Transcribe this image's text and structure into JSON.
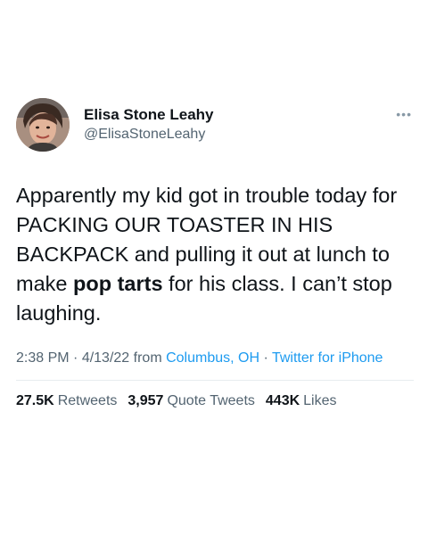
{
  "user": {
    "display_name": "Elisa Stone Leahy",
    "handle": "@ElisaStoneLeahy"
  },
  "more_icon": "more-options-icon",
  "tweet": {
    "text_part1": "Apparently my kid got in trouble today for PACKING OUR TOASTER IN HIS BACKPACK and pulling it out at lunch to make ",
    "text_bold": "pop tarts",
    "text_part2": " for his class. I can’t stop laughing."
  },
  "meta": {
    "time": "2:38 PM",
    "sep1": " · ",
    "date": "4/13/22",
    "from": " from ",
    "location": "Columbus, OH",
    "sep2": " · ",
    "source": "Twitter for iPhone"
  },
  "stats": {
    "retweets_count": "27.5K",
    "retweets_label": "Retweets",
    "quotes_count": "3,957",
    "quotes_label": "Quote Tweets",
    "likes_count": "443K",
    "likes_label": "Likes"
  },
  "colors": {
    "link": "#1d9bf0",
    "secondary_text": "#536471",
    "primary_text": "#0f1419"
  }
}
